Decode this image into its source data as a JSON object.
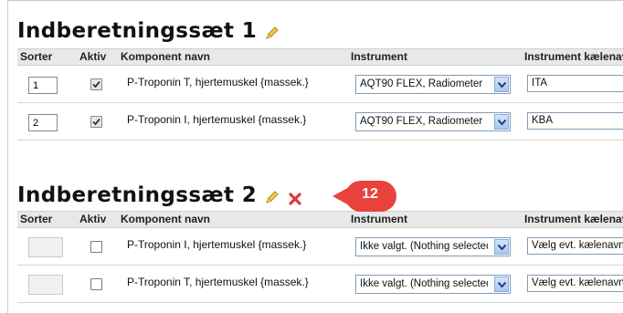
{
  "set1": {
    "title": "Indberetningssæt 1",
    "columns": [
      "Sorter",
      "Aktiv",
      "Komponent navn",
      "Instrument",
      "Instrument kælenavn"
    ],
    "rows": [
      {
        "sort": "1",
        "active": true,
        "component": "P-Troponin T, hjertemuskel {massek.}",
        "instrument": "AQT90 FLEX, Radiometer",
        "nickname": "ITA"
      },
      {
        "sort": "2",
        "active": true,
        "component": "P-Troponin I, hjertemuskel {massek.}",
        "instrument": "AQT90 FLEX, Radiometer",
        "nickname": "KBA"
      }
    ]
  },
  "set2": {
    "title": "Indberetningssæt 2",
    "columns": [
      "Sorter",
      "Aktiv",
      "Komponent navn",
      "Instrument",
      "Instrument kælenavn"
    ],
    "rows": [
      {
        "sort": "",
        "active": false,
        "component": "P-Troponin I, hjertemuskel {massek.}",
        "instrument": "Ikke valgt. (Nothing selected)",
        "nickname": "Vælg evt. kælenavn"
      },
      {
        "sort": "",
        "active": false,
        "component": "P-Troponin T, hjertemuskel {massek.}",
        "instrument": "Ikke valgt. (Nothing selected)",
        "nickname": "Vælg evt. kælenavn"
      }
    ]
  },
  "callout": {
    "number": "12",
    "color": "#e8423d"
  },
  "colors": {
    "header_bg": "#e8e8e8",
    "delete": "#e03a3a",
    "pencil": "#e6b422"
  },
  "icons": [
    "pencil-icon",
    "delete-x-icon",
    "checkbox-check-icon",
    "dropdown-arrow-icon"
  ]
}
